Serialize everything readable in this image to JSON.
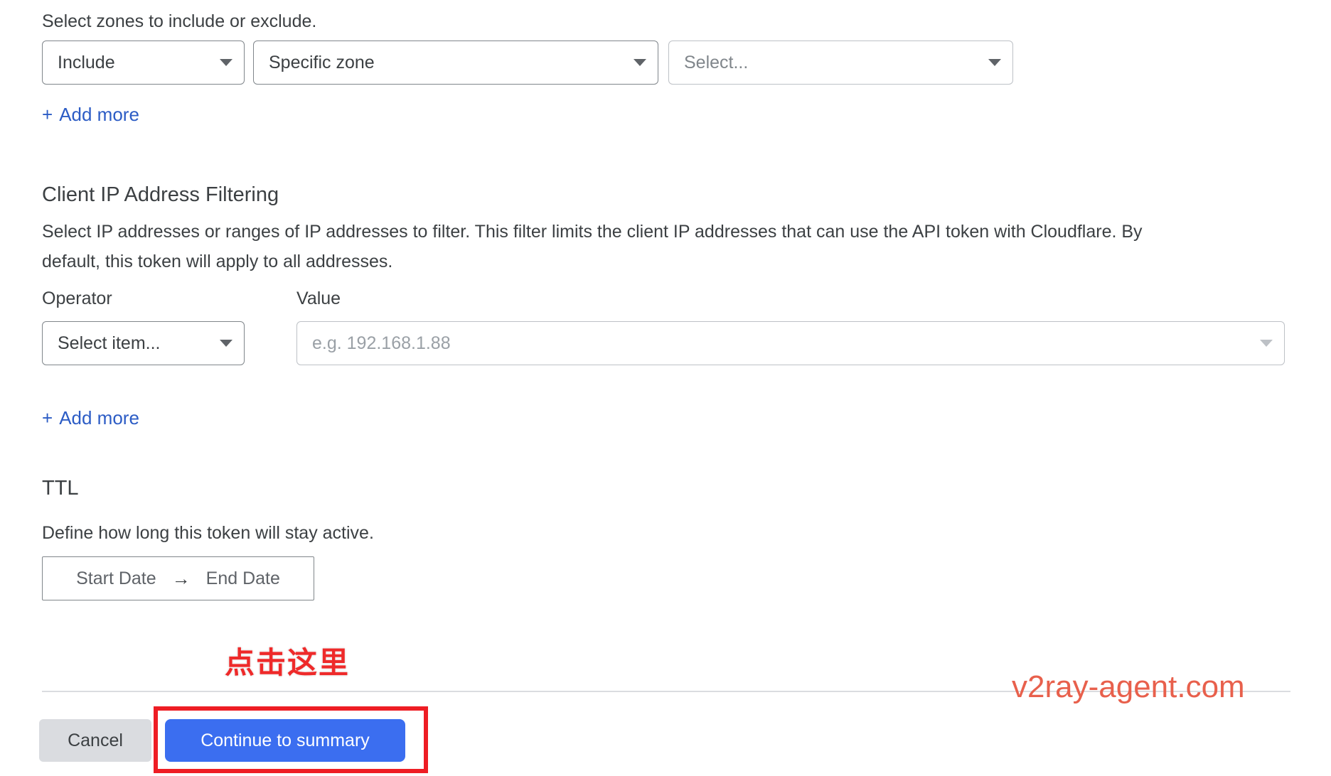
{
  "zones": {
    "hint": "Select zones to include or exclude.",
    "mode_select": {
      "value": "Include",
      "caret": "chevron-down-icon"
    },
    "type_select": {
      "value": "Specific zone",
      "caret": "chevron-down-icon"
    },
    "value_select": {
      "placeholder": "Select...",
      "caret": "chevron-down-icon"
    },
    "add_more": {
      "plus": "+",
      "label": "Add more"
    }
  },
  "client_ip": {
    "heading": "Client IP Address Filtering",
    "description": "Select IP addresses or ranges of IP addresses to filter. This filter limits the client IP addresses that can use the API token with Cloudflare. By default, this token will apply to all addresses.",
    "operator_label": "Operator",
    "value_label": "Value",
    "operator_select": {
      "value": "Select item...",
      "caret": "chevron-down-icon"
    },
    "value_input": {
      "placeholder": "e.g. 192.168.1.88",
      "caret": "chevron-down-icon"
    },
    "add_more": {
      "plus": "+",
      "label": "Add more"
    }
  },
  "ttl": {
    "heading": "TTL",
    "description": "Define how long this token will stay active.",
    "start_date": "Start Date",
    "arrow": "→",
    "end_date": "End Date"
  },
  "footer": {
    "cancel_label": "Cancel",
    "continue_label": "Continue to summary"
  },
  "annotations": {
    "click_here": "点击这里",
    "watermark": "v2ray-agent.com"
  },
  "colors": {
    "primary_button": "#3b6ef0",
    "link": "#2c5cc5",
    "annotation_red": "#ee1d24",
    "watermark": "#e8604c",
    "cancel_button": "#dadce0",
    "border": "#80868b",
    "placeholder": "#9aa0a6"
  }
}
